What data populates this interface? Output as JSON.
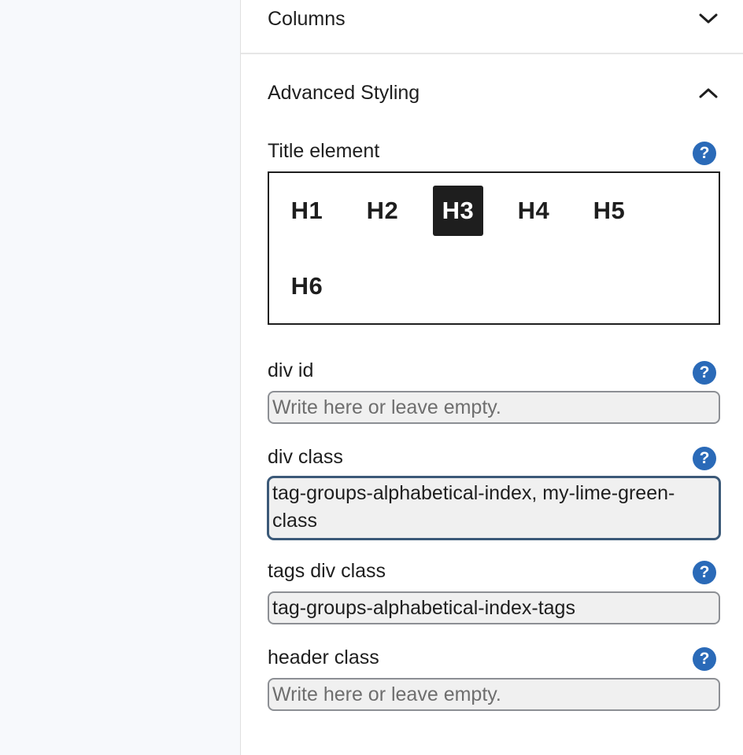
{
  "sections": {
    "columns": {
      "title": "Columns",
      "expanded": false
    },
    "advanced": {
      "title": "Advanced Styling",
      "expanded": true
    }
  },
  "title_element": {
    "label": "Title element",
    "options": [
      "H1",
      "H2",
      "H3",
      "H4",
      "H5",
      "H6"
    ],
    "selected": "H3"
  },
  "fields": {
    "div_id": {
      "label": "div id",
      "value": "",
      "placeholder": "Write here or leave empty."
    },
    "div_class": {
      "label": "div class",
      "value": "tag-groups-alphabetical-index, my-lime-green-class",
      "placeholder": "Write here or leave empty."
    },
    "tags_div_class": {
      "label": "tags div class",
      "value": "tag-groups-alphabetical-index-tags",
      "placeholder": "Write here or leave empty."
    },
    "header_class": {
      "label": "header class",
      "value": "",
      "placeholder": "Write here or leave empty."
    }
  },
  "help_symbol": "?",
  "icons": {
    "collapsed": "chevron-down-icon",
    "expanded": "chevron-up-icon",
    "help": "help-icon"
  },
  "colors": {
    "help": "#2a6ab8",
    "selected_heading_bg": "#1e1e1e",
    "focus_border": "#3b5978"
  }
}
